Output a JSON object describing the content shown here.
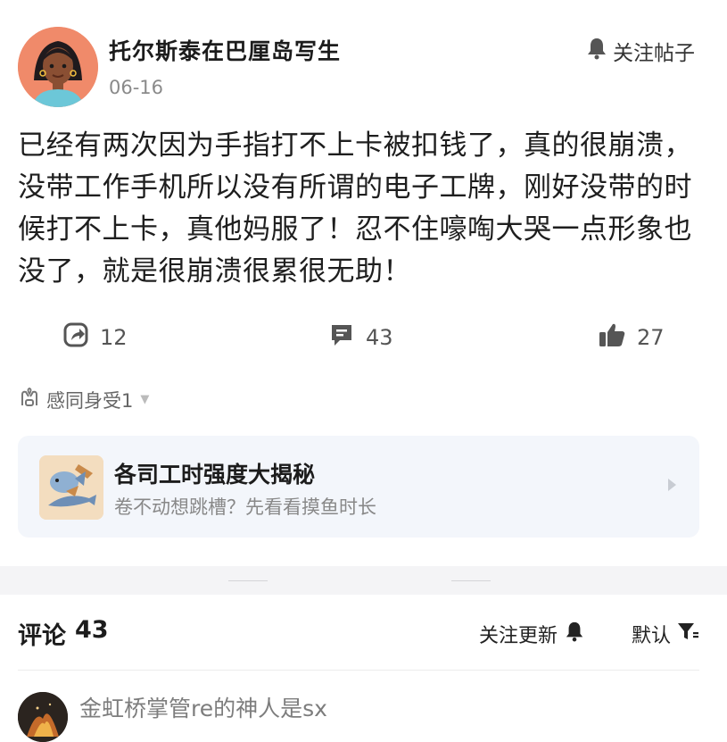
{
  "post": {
    "author": "托尔斯泰在巴厘岛写生",
    "date": "06-16",
    "follow_label": "关注帖子",
    "text": "已经有两次因为手指打不上卡被扣钱了，真的很崩溃，没带工作手机所以没有所谓的电子工牌，刚好没带的时候打不上卡，真他妈服了！忍不住嚎啕大哭一点形象也没了，就是很崩溃很累很无助！"
  },
  "actions": {
    "share_count": "12",
    "comment_count": "43",
    "like_count": "27"
  },
  "empathy": {
    "label": "感同身受1"
  },
  "topic_card": {
    "title": "各司工时强度大揭秘",
    "subtitle": "卷不动想跳槽？先看看摸鱼时长"
  },
  "comments_section": {
    "title": "评论",
    "count": "43",
    "follow_updates": "关注更新",
    "sort_label": "默认"
  },
  "first_comment": {
    "name": "金虹桥掌管re的神人是sx"
  },
  "icons": {
    "follow": "bell-icon",
    "share": "share-arrow-icon",
    "comment": "comment-bubble-icon",
    "like": "thumbs-up-icon",
    "empathy": "hands-heart-icon",
    "sort": "filter-icon"
  },
  "colors": {
    "card_bg": "#f3f6fb",
    "avatar_bg": "#f08a6a",
    "icon_gray": "#555555"
  }
}
